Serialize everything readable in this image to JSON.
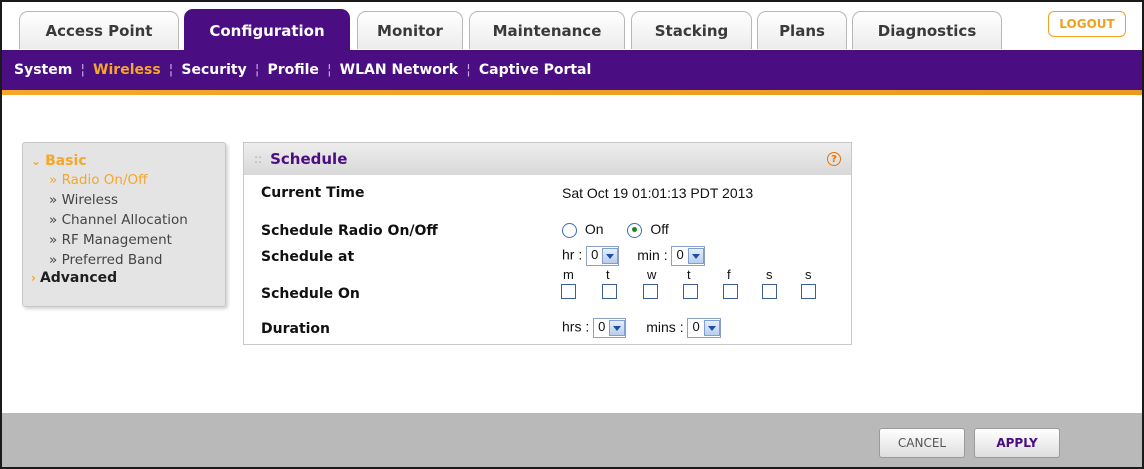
{
  "tabs": [
    "Access Point",
    "Configuration",
    "Monitor",
    "Maintenance",
    "Stacking",
    "Plans",
    "Diagnostics"
  ],
  "active_tab": "Configuration",
  "logout_label": "LOGOUT",
  "subnav": [
    "System",
    "Wireless",
    "Security",
    "Profile",
    "WLAN Network",
    "Captive Portal"
  ],
  "active_subnav": "Wireless",
  "left_menu": {
    "basic_label": "Basic",
    "basic_items": [
      "Radio On/Off",
      "Wireless",
      "Channel Allocation",
      "RF Management",
      "Preferred Band"
    ],
    "active_item": "Radio On/Off",
    "advanced_label": "Advanced",
    "bullet": "»",
    "arrow_expanded": "⌄",
    "arrow_collapsed": "›"
  },
  "panel": {
    "title": "Schedule",
    "help_label": "?",
    "current_time_label": "Current Time",
    "current_time_value": "Sat Oct 19 01:01:13 PDT 2013",
    "schedule_radio_label": "Schedule Radio On/Off",
    "on_label": "On",
    "off_label": "Off",
    "radio_selected": "Off",
    "schedule_at_label": "Schedule at",
    "hr_label": "hr :",
    "hr_value": "0",
    "min_label": "min :",
    "min_value": "0",
    "schedule_on_label": "Schedule On",
    "days": [
      "m",
      "t",
      "w",
      "t",
      "f",
      "s",
      "s"
    ],
    "duration_label": "Duration",
    "hrs_label": "hrs :",
    "hrs_value": "0",
    "mins_label": "mins :",
    "mins_value": "0"
  },
  "footer": {
    "cancel_label": "CANCEL",
    "apply_label": "APPLY"
  },
  "colors": {
    "brand_purple": "#4a0d82",
    "accent_orange": "#f4a72a"
  }
}
